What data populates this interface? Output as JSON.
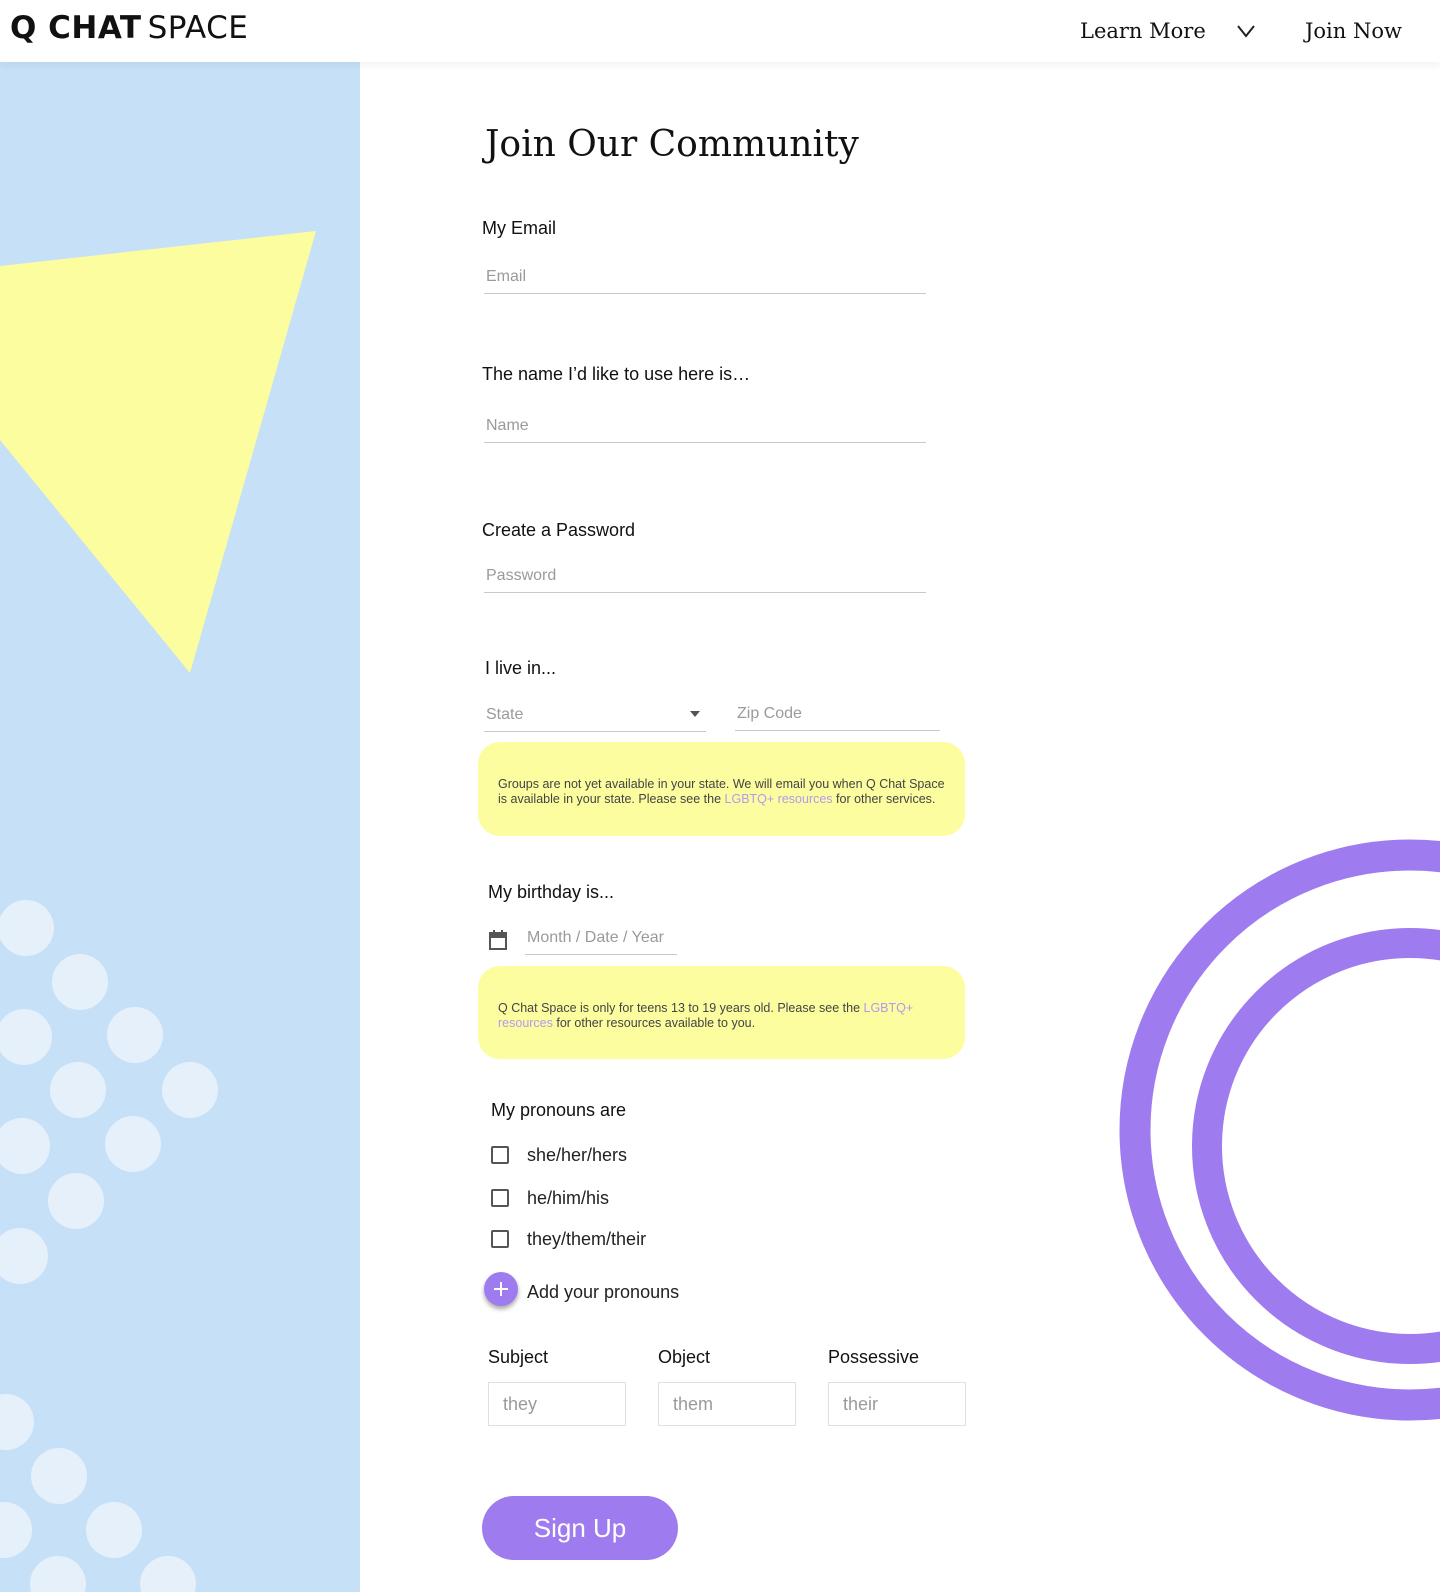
{
  "header": {
    "logo_bold": "Q CHAT",
    "logo_light": "SPACE",
    "nav_learn_more": "Learn More",
    "nav_join_now": "Join Now"
  },
  "form": {
    "title": "Join Our Community",
    "email": {
      "label": "My Email",
      "placeholder": "Email",
      "value": ""
    },
    "name": {
      "label": "The name I’d like to use here is…",
      "placeholder": "Name",
      "value": ""
    },
    "password": {
      "label": "Create a Password",
      "placeholder": "Password",
      "value": ""
    },
    "location": {
      "label": "I live in...",
      "state_placeholder": "State",
      "zip_placeholder": "Zip Code"
    },
    "state_notice": {
      "text_before": "Groups are not yet available in your state. We will email you when Q Chat Space is available in your state. Please see the ",
      "link": "LGBTQ+ resources",
      "text_after": " for other services."
    },
    "birthday": {
      "label": "My birthday is...",
      "placeholder": "Month / Date / Year",
      "icon": "calendar-icon"
    },
    "age_notice": {
      "text_before": "Q Chat Space is only for teens 13 to 19 years old. Please see the ",
      "link": "LGBTQ+ resources",
      "text_after": " for other resources available to you."
    },
    "pronouns": {
      "label": "My pronouns are",
      "options": [
        {
          "label": "she/her/hers",
          "checked": false
        },
        {
          "label": "he/him/his",
          "checked": false
        },
        {
          "label": "they/them/their",
          "checked": false
        }
      ],
      "add_label": "Add your pronouns",
      "custom": {
        "subject_label": "Subject",
        "subject_placeholder": "they",
        "object_label": "Object",
        "object_placeholder": "them",
        "possessive_label": "Possessive",
        "possessive_placeholder": "their"
      }
    },
    "submit_label": "Sign Up"
  },
  "colors": {
    "accent": "#9e7bee",
    "panel_blue": "#c6e0f8",
    "triangle_yellow": "#fbfd9f",
    "notice_yellow": "#fbfd9f",
    "link_purple": "#b39af0"
  }
}
